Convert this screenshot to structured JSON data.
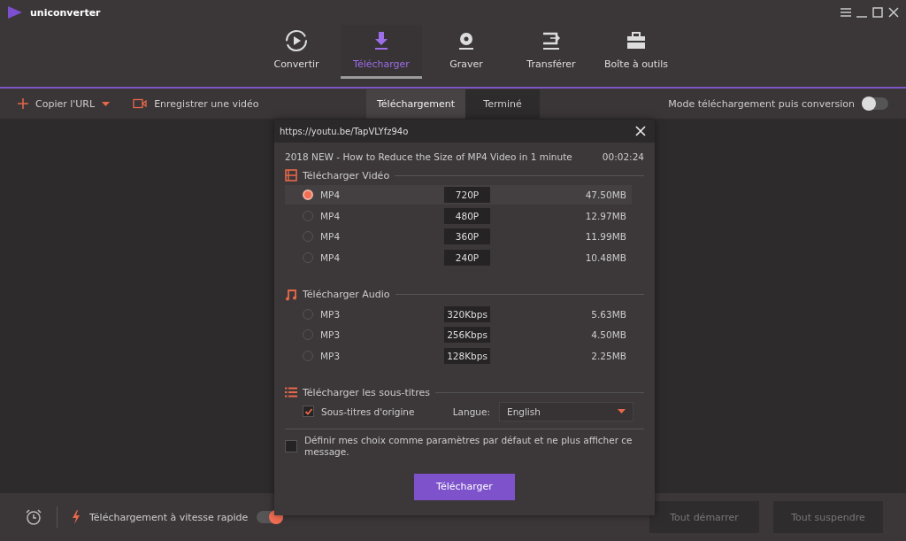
{
  "app": {
    "title": "uniconverter"
  },
  "nav": [
    {
      "label": "Convertir",
      "kind": "convert",
      "selected": false
    },
    {
      "label": "Télécharger",
      "kind": "download",
      "selected": true
    },
    {
      "label": "Graver",
      "kind": "burn",
      "selected": false
    },
    {
      "label": "Transférer",
      "kind": "transfer",
      "selected": false
    },
    {
      "label": "Boîte à outils",
      "kind": "toolbox",
      "selected": false
    }
  ],
  "toolbar": {
    "copy_url": "Copier l'URL",
    "record": "Enregistrer une vidéo",
    "tabs": [
      {
        "label": "Téléchargement",
        "selected": true
      },
      {
        "label": "Terminé",
        "selected": false
      }
    ],
    "mode_label": "Mode téléchargement puis conversion",
    "mode_on": false
  },
  "dialog": {
    "url": "https://youtu.be/TapVLYfz94o",
    "video_title": "2018 NEW - How to Reduce the Size of MP4 Video in 1 minute",
    "duration": "00:02:24",
    "sections": [
      {
        "kind": "video",
        "title": "Télécharger Vidéo",
        "options": [
          {
            "format": "MP4",
            "quality": "720P",
            "size": "47.50MB",
            "selected": true
          },
          {
            "format": "MP4",
            "quality": "480P",
            "size": "12.97MB",
            "selected": false
          },
          {
            "format": "MP4",
            "quality": "360P",
            "size": "11.99MB",
            "selected": false
          },
          {
            "format": "MP4",
            "quality": "240P",
            "size": "10.48MB",
            "selected": false
          }
        ]
      },
      {
        "kind": "audio",
        "title": "Télécharger Audio",
        "options": [
          {
            "format": "MP3",
            "quality": "320Kbps",
            "size": "5.63MB",
            "selected": false
          },
          {
            "format": "MP3",
            "quality": "256Kbps",
            "size": "4.50MB",
            "selected": false
          },
          {
            "format": "MP3",
            "quality": "128Kbps",
            "size": "2.25MB",
            "selected": false
          }
        ]
      }
    ],
    "subtitles": {
      "title": "Télécharger les sous-titres",
      "original_label": "Sous-titres d'origine",
      "original_checked": true,
      "language_label": "Langue:",
      "language": "English"
    },
    "default_label": "Définir mes choix comme paramètres par défaut et ne plus afficher ce message.",
    "default_checked": false,
    "button": "Télécharger"
  },
  "bottom": {
    "fast_label": "Téléchargement à vitesse rapide",
    "fast_on": true,
    "buttons": [
      {
        "label": "Tout démarrer",
        "disabled": true
      },
      {
        "label": "Tout suspendre",
        "disabled": true
      }
    ]
  }
}
